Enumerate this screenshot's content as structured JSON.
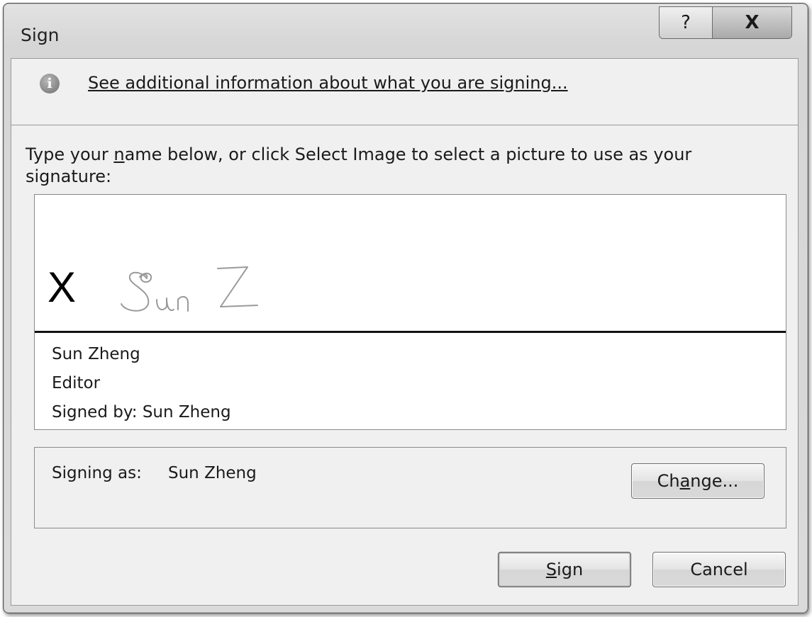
{
  "window": {
    "title": "Sign",
    "help_glyph": "?",
    "close_glyph": "X"
  },
  "info": {
    "icon": "i",
    "link_text": "See additional information about what you are signing..."
  },
  "instruction": {
    "prefix": "Type your ",
    "mnemonic": "n",
    "suffix": "ame below, or click Select Image to select a picture to use as your signature:"
  },
  "signature": {
    "x_mark": "X",
    "handwriting_text": "Sun Z",
    "signer_name": "Sun Zheng",
    "signer_title": "Editor",
    "signed_by": "Signed by: Sun Zheng"
  },
  "signing_as": {
    "label": "Signing as:",
    "value": "Sun Zheng",
    "change_button": {
      "before": "Ch",
      "mnemonic": "a",
      "after": "nge..."
    }
  },
  "buttons": {
    "sign_mnemonic": "S",
    "sign_rest": "ign",
    "cancel": "Cancel"
  }
}
